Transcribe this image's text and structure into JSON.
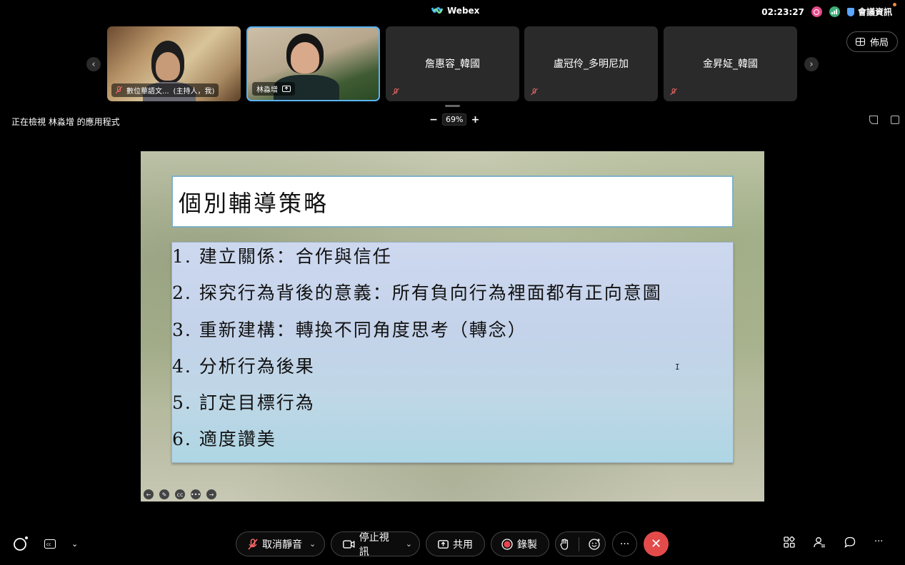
{
  "app": {
    "title": "Webex",
    "time": "02:23:27",
    "meeting_info": "會議資訊"
  },
  "participants": [
    {
      "name": "數位華語文...",
      "role": "(主持人，我)",
      "muted": true,
      "video": true
    },
    {
      "name": "林淼增",
      "muted": false,
      "video": true,
      "active": true
    },
    {
      "name": "詹惠容_韓國",
      "muted": true,
      "video": false
    },
    {
      "name": "盧冠伶_多明尼加",
      "muted": true,
      "video": false
    },
    {
      "name": "金昇姃_韓國",
      "muted": true,
      "video": false
    }
  ],
  "layout_button": "佈局",
  "share": {
    "viewing_label": "正在檢視 林淼增 的應用程式",
    "zoom_minus": "−",
    "zoom": "69%",
    "zoom_plus": "+"
  },
  "slide": {
    "title": "個別輔導策略",
    "items": [
      "1. 建立關係：合作與信任",
      "2. 探究行為背後的意義：所有負向行為裡面都有正向意圖",
      "3. 重新建構：轉換不同角度思考（轉念）",
      "4. 分析行為後果",
      "5. 訂定目標行為",
      "6. 適度讚美"
    ]
  },
  "controls": {
    "mute": "取消靜音",
    "video": "停止視訊",
    "share": "共用",
    "record": "錄製",
    "more": "···"
  },
  "colors": {
    "end_call": "#e34b4b",
    "active_border": "#5bb3f0",
    "record": "#e8434f"
  }
}
